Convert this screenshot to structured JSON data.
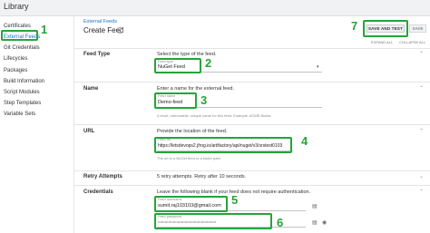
{
  "app": {
    "title": "Library"
  },
  "sidebar": {
    "items": [
      {
        "label": "Certificates"
      },
      {
        "label": "External Feeds"
      },
      {
        "label": "Git Credentials"
      },
      {
        "label": "Lifecycles"
      },
      {
        "label": "Packages"
      },
      {
        "label": "Build Information"
      },
      {
        "label": "Script Modules"
      },
      {
        "label": "Step Templates"
      },
      {
        "label": "Variable Sets"
      }
    ]
  },
  "header": {
    "breadcrumb": "External Feeds",
    "title": "Create Feed",
    "save_and_test": "SAVE AND TEST",
    "save": "SAVE",
    "expand_all": "EXPAND ALL",
    "collapse_all": "COLLAPSE ALL"
  },
  "annotations": [
    "1",
    "2",
    "3",
    "4",
    "5",
    "6",
    "7"
  ],
  "sections": {
    "feed_type": {
      "title": "Feed Type",
      "description": "Select the type of the feed.",
      "field_label": "Feed type",
      "value": "NuGet Feed"
    },
    "name": {
      "title": "Name",
      "description": "Enter a name for the external feed.",
      "field_label": "Feed name",
      "value": "Demo-feed",
      "help": "A short, memorable, unique name for this feed. Example: ACME Builds."
    },
    "url": {
      "title": "URL",
      "description": "Provide the location of the feed.",
      "field_label": "Feed url",
      "value": "https://letsdevops2.jfrog.io/artifactory/api/nuget/v3/srstest0103",
      "help": "The url to a NuGet feed or a folder path"
    },
    "retry": {
      "title": "Retry Attempts",
      "description": "5 retry attempts. Retry after 10 seconds."
    },
    "credentials": {
      "title": "Credentials",
      "description": "Leave the following blank if your feed does not require authentication.",
      "username_label": "Feed username",
      "username": "sumit.raj103103@gmail.com",
      "password_label": "Feed password",
      "password": "••••••••••••••••••••••••••••••••••••••••••••••••••"
    }
  }
}
